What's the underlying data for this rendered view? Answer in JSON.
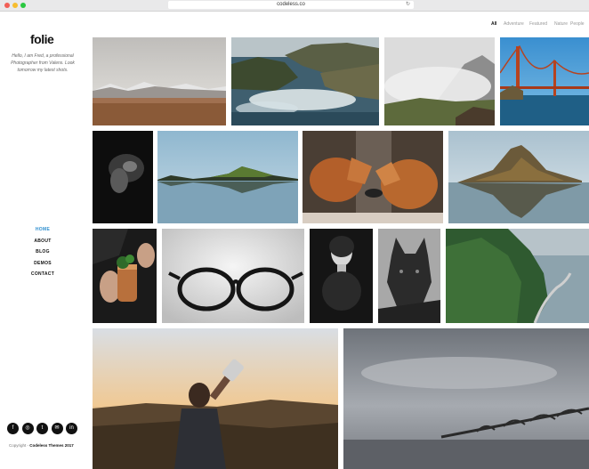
{
  "browser": {
    "url": "codeless.co"
  },
  "site": {
    "logo": "folie",
    "intro": "Hello, I am Fred, a professional Photographer from Valens. Look tomorrow my latest shots.",
    "copyright_prefix": "Copyright - ",
    "copyright_brand": "Codeless Themes 2017"
  },
  "nav": {
    "items": [
      {
        "label": "HOME",
        "active": true
      },
      {
        "label": "ABOUT"
      },
      {
        "label": "BLOG"
      },
      {
        "label": "DEMOS"
      },
      {
        "label": "CONTACT"
      }
    ]
  },
  "social": [
    {
      "icon": "facebook-icon",
      "glyph": "f"
    },
    {
      "icon": "instagram-icon",
      "glyph": "◎"
    },
    {
      "icon": "twitter-icon",
      "glyph": "t"
    },
    {
      "icon": "email-icon",
      "glyph": "✉"
    },
    {
      "icon": "linkedin-icon",
      "glyph": "in"
    }
  ],
  "filters": {
    "tabs": [
      {
        "label": "All",
        "active": true
      },
      {
        "label": "Adventure"
      },
      {
        "label": "Featured"
      },
      {
        "label": "Nature"
      },
      {
        "label": "People"
      }
    ]
  },
  "gallery": [
    {
      "subject": "misty-mountain-plain"
    },
    {
      "subject": "rocky-coast-waves"
    },
    {
      "subject": "foggy-mountain"
    },
    {
      "subject": "golden-gate-bridge"
    },
    {
      "subject": "dark-animal"
    },
    {
      "subject": "lake-island-reflection"
    },
    {
      "subject": "two-foxes"
    },
    {
      "subject": "kirkjufell-mountain"
    },
    {
      "subject": "copper-mug-drink"
    },
    {
      "subject": "black-glasses"
    },
    {
      "subject": "woman-portrait"
    },
    {
      "subject": "black-wolf"
    },
    {
      "subject": "forest-coastline"
    },
    {
      "subject": "man-drinking-bottle"
    },
    {
      "subject": "long-bridge-sea"
    }
  ]
}
